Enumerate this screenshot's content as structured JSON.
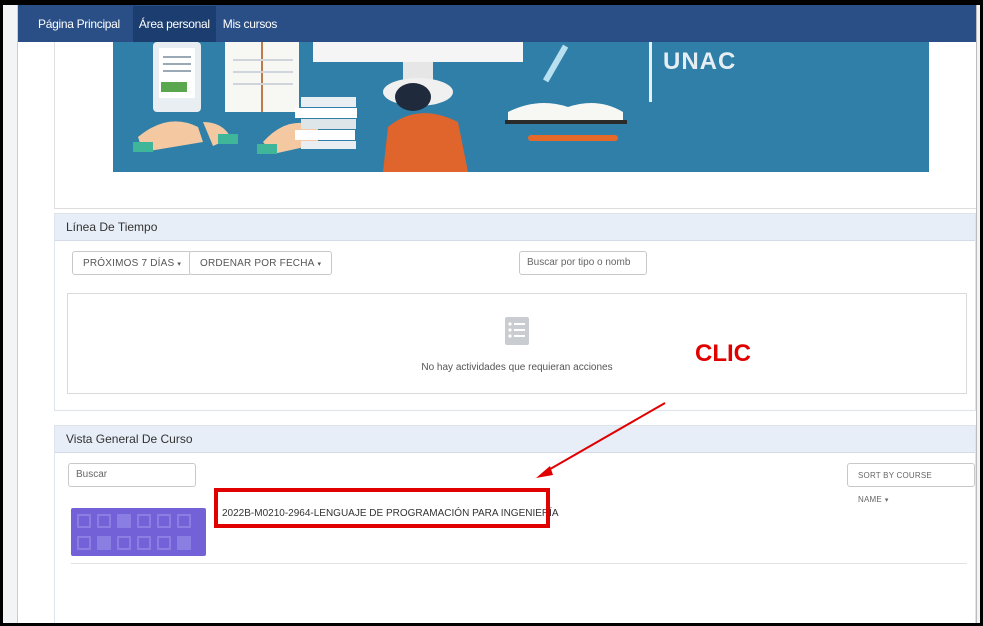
{
  "navbar": {
    "items": [
      {
        "label": "Página Principal"
      },
      {
        "label": "Área personal",
        "active": true
      },
      {
        "label": "Mis cursos"
      }
    ],
    "color": "#2a4f86"
  },
  "banner": {
    "logo_text": "UNAC",
    "color": "#2f7fa8"
  },
  "timeline": {
    "title": "Línea De Tiempo",
    "filter_label": "PRÓXIMOS 7 DÍAS",
    "sort_label": "ORDENAR POR FECHA",
    "search_placeholder": "Buscar por tipo o nomb",
    "empty_message": "No hay actividades que requieran acciones"
  },
  "course_overview": {
    "title": "Vista General De Curso",
    "search_placeholder": "Buscar",
    "sort_label": "SORT BY COURSE NAME",
    "courses": [
      {
        "name": "2022B-M0210-2964-LENGUAJE DE PROGRAMACIÓN PARA INGENIERÍA",
        "image_color": "#7362d7"
      }
    ]
  },
  "annotation": {
    "label": "CLIC",
    "color": "#e10000"
  }
}
